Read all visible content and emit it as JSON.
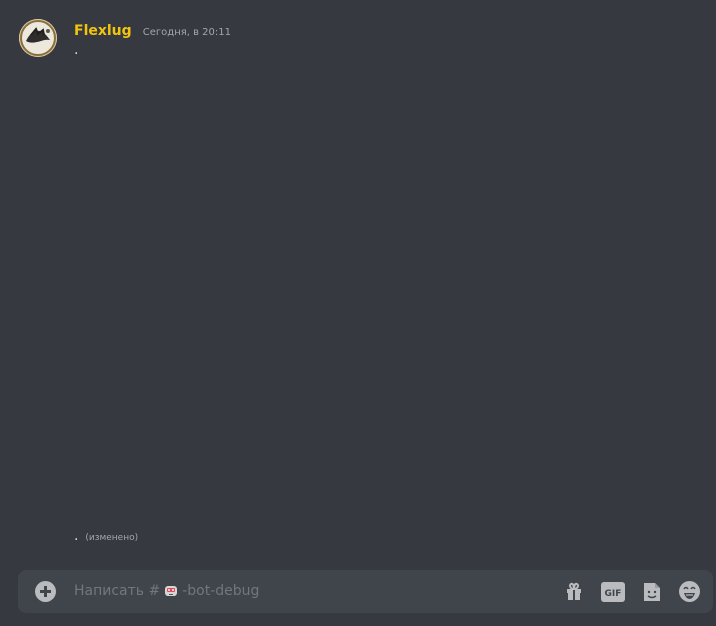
{
  "message": {
    "author": "Flexlug",
    "timestamp": "Сегодня, в 20:11",
    "content": "."
  },
  "edited_message": {
    "content": ".",
    "edited_label": "(изменено)"
  },
  "composer": {
    "placeholder_prefix": "Написать #",
    "channel_name": "-bot-debug",
    "icons": [
      "plus-icon",
      "robot-icon",
      "gift-icon",
      "gif-icon",
      "sticker-icon",
      "emoji-icon"
    ],
    "gif_label": "GIF"
  },
  "colors": {
    "background": "#36393f",
    "composer": "#40444b",
    "author": "#f1c40f",
    "text": "#dcddde",
    "muted": "#a3a6aa",
    "icon": "#b9bbbe"
  }
}
